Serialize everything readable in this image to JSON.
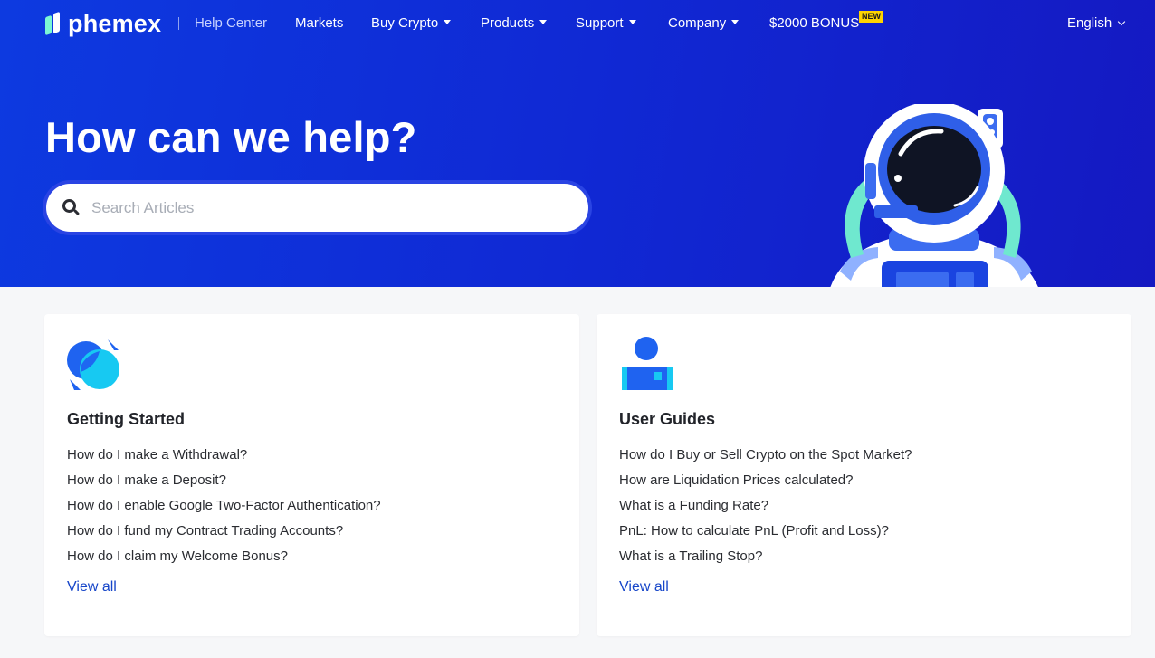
{
  "brand": {
    "name": "phemex"
  },
  "nav": {
    "help_center": "Help Center",
    "items": [
      {
        "label": "Markets"
      },
      {
        "label": "Buy Crypto"
      },
      {
        "label": "Products"
      },
      {
        "label": "Support"
      },
      {
        "label": "Company"
      },
      {
        "label": "$2000 BONUS"
      }
    ],
    "new_badge": "NEW",
    "language": "English"
  },
  "hero": {
    "title": "How can we help?",
    "search_placeholder": "Search Articles"
  },
  "cards": [
    {
      "title": "Getting Started",
      "icon": "getting-started-icon",
      "articles": [
        "How do I make a Withdrawal?",
        "How do I make a Deposit?",
        "How do I enable Google Two-Factor Authentication?",
        "How do I fund my Contract Trading Accounts?",
        "How do I claim my Welcome Bonus?"
      ],
      "view_all": "View all"
    },
    {
      "title": "User Guides",
      "icon": "user-guides-icon",
      "articles": [
        "How do I Buy or Sell Crypto on the Spot Market?",
        "How are Liquidation Prices calculated?",
        "What is a Funding Rate?",
        "PnL: How to calculate PnL (Profit and Loss)?",
        "What is a Trailing Stop?"
      ],
      "view_all": "View all"
    }
  ],
  "colors": {
    "hero_start": "#0d3ae0",
    "hero_end": "#1519c2",
    "link": "#1746c9",
    "badge": "#ffd400"
  }
}
